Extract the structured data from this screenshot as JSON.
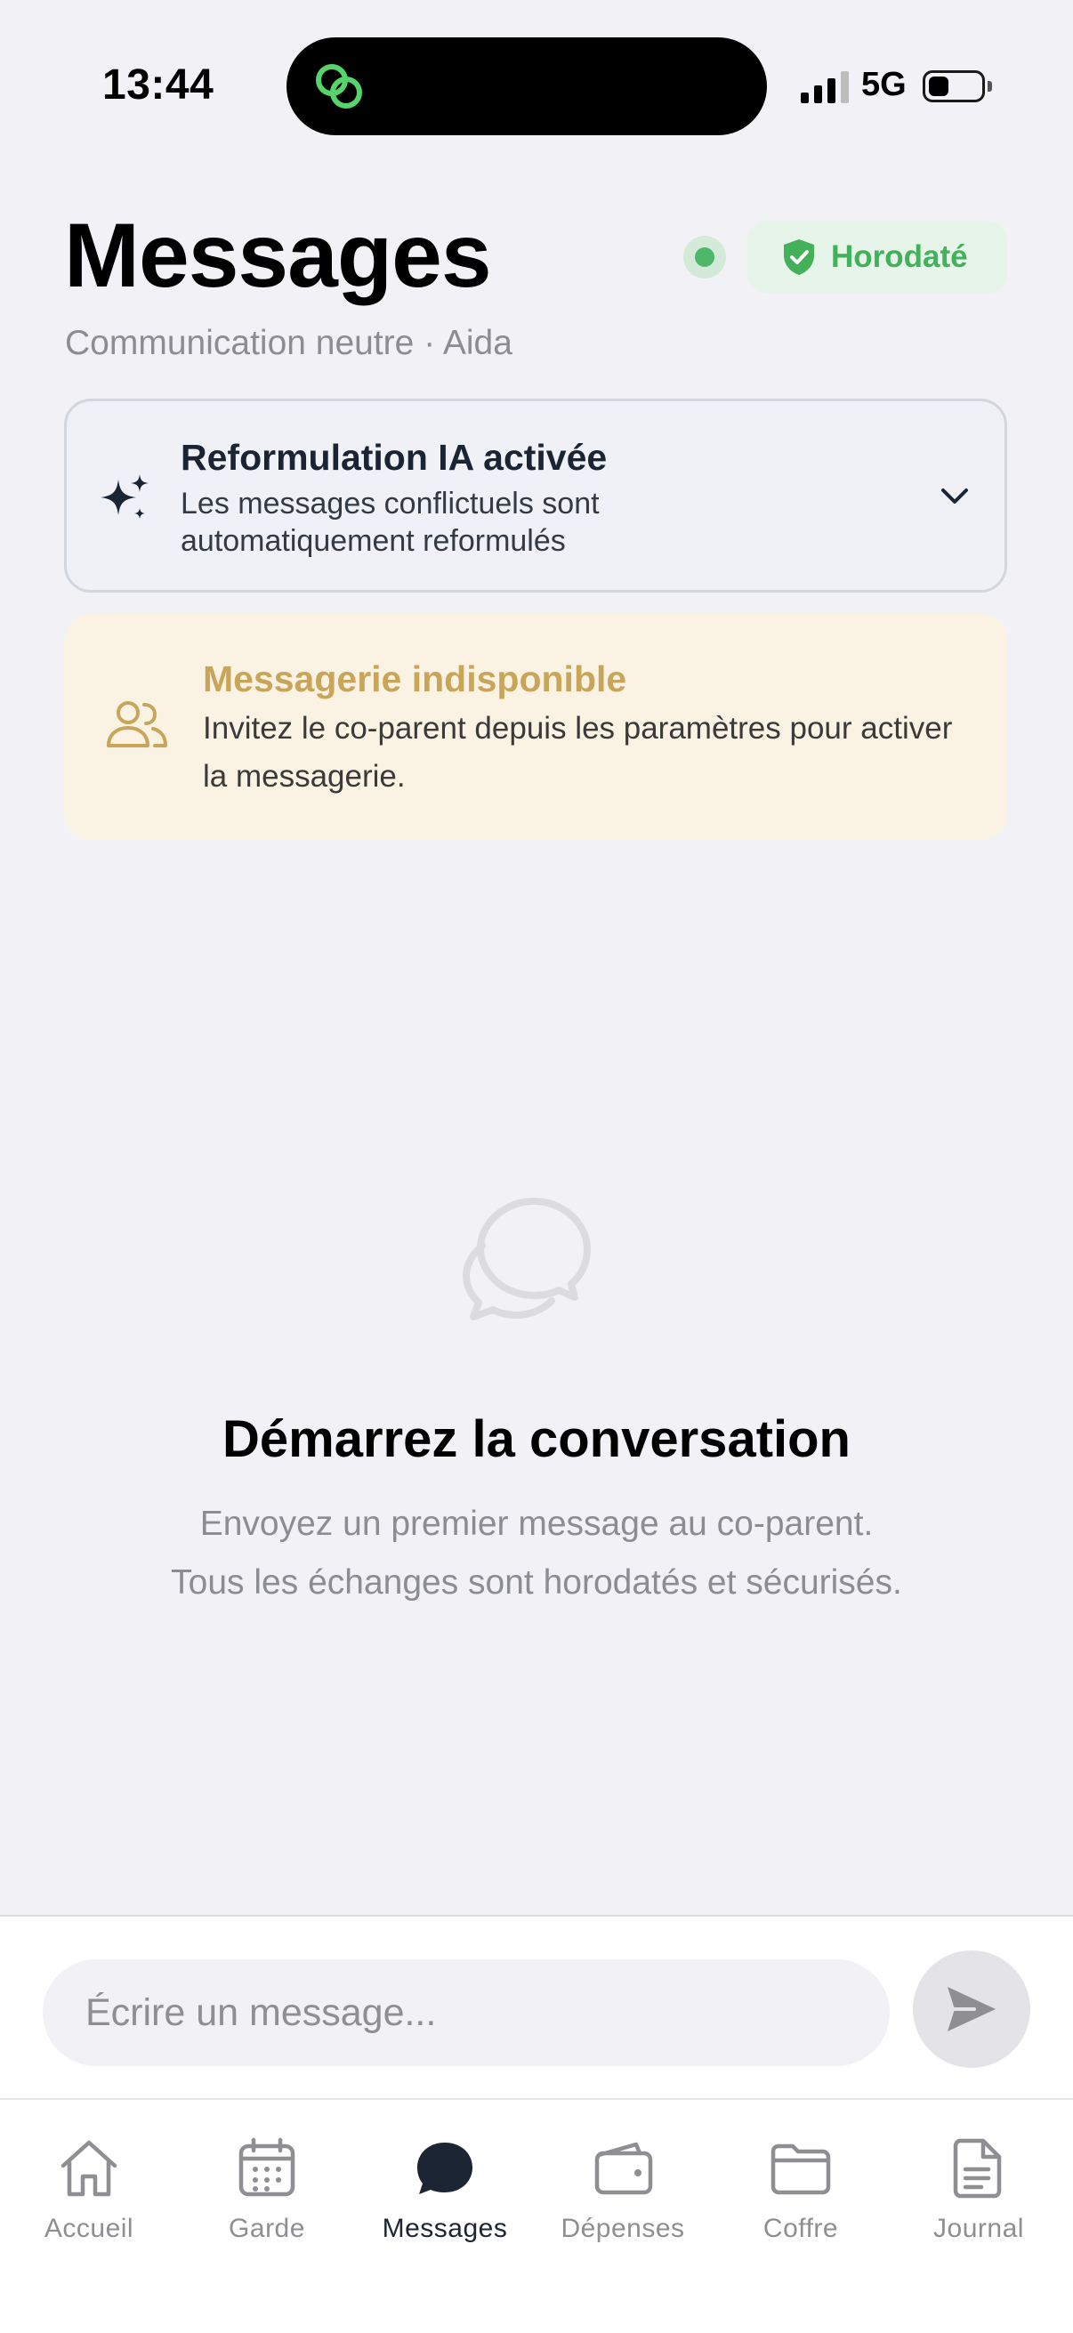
{
  "status_bar": {
    "time": "13:44",
    "network": "5G",
    "island_app_icon": "linked-rings-icon"
  },
  "header": {
    "title": "Messages",
    "subtitle": "Communication neutre · Aida",
    "online_indicator_color": "#4cb868",
    "badge": {
      "icon": "shield-check-icon",
      "label": "Horodaté",
      "color": "#43b05a"
    }
  },
  "ai_card": {
    "icon": "sparkles-icon",
    "title": "Reformulation IA activée",
    "description": "Les messages conflictuels sont automatiquement reformulés",
    "toggle_icon": "chevron-down-icon"
  },
  "warning": {
    "icon": "users-icon",
    "title": "Messagerie indisponible",
    "description": "Invitez le co-parent depuis les paramètres pour activer la messagerie.",
    "accent_color": "#c9a55a"
  },
  "empty_state": {
    "icon": "chat-bubbles-icon",
    "title": "Démarrez la conversation",
    "line1": "Envoyez un premier message au co-parent.",
    "line2": "Tous les échanges sont horodatés et sécurisés."
  },
  "composer": {
    "placeholder": "Écrire un message...",
    "send_icon": "send-icon"
  },
  "tabs": [
    {
      "label": "Accueil",
      "icon": "home-icon",
      "active": false
    },
    {
      "label": "Garde",
      "icon": "calendar-icon",
      "active": false
    },
    {
      "label": "Messages",
      "icon": "chat-icon",
      "active": true
    },
    {
      "label": "Dépenses",
      "icon": "wallet-icon",
      "active": false
    },
    {
      "label": "Coffre",
      "icon": "folder-icon",
      "active": false
    },
    {
      "label": "Journal",
      "icon": "document-icon",
      "active": false
    }
  ]
}
